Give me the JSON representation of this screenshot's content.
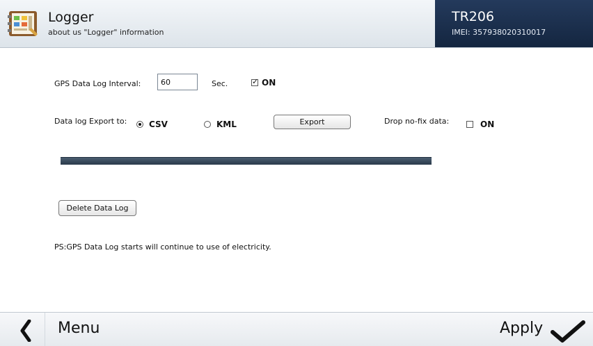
{
  "header": {
    "title": "Logger",
    "subtitle": "about us \"Logger\" information",
    "device": {
      "name": "TR206",
      "imei": "IMEI: 357938020310017"
    },
    "icon": "notebook-icon"
  },
  "gps_interval": {
    "label": "GPS Data Log Interval:",
    "value": "60",
    "unit": "Sec.",
    "on_label": "ON",
    "on_checked": true
  },
  "export": {
    "label": "Data log Export to:",
    "options": [
      "CSV",
      "KML"
    ],
    "selected": "CSV",
    "button": "Export",
    "drop_label": "Drop no-fix data:",
    "drop_on_label": "ON",
    "drop_checked": false
  },
  "progress": {
    "fraction": 1.0
  },
  "delete_button": "Delete Data Log",
  "note": "PS:GPS Data Log starts will continue to use of electricity.",
  "footer": {
    "menu": "Menu",
    "apply": "Apply",
    "back_icon": "chevron-left-icon",
    "apply_icon": "checkmark-icon"
  },
  "colors": {
    "header_dark": "#1e3254",
    "progress": "#3a4b5c"
  }
}
